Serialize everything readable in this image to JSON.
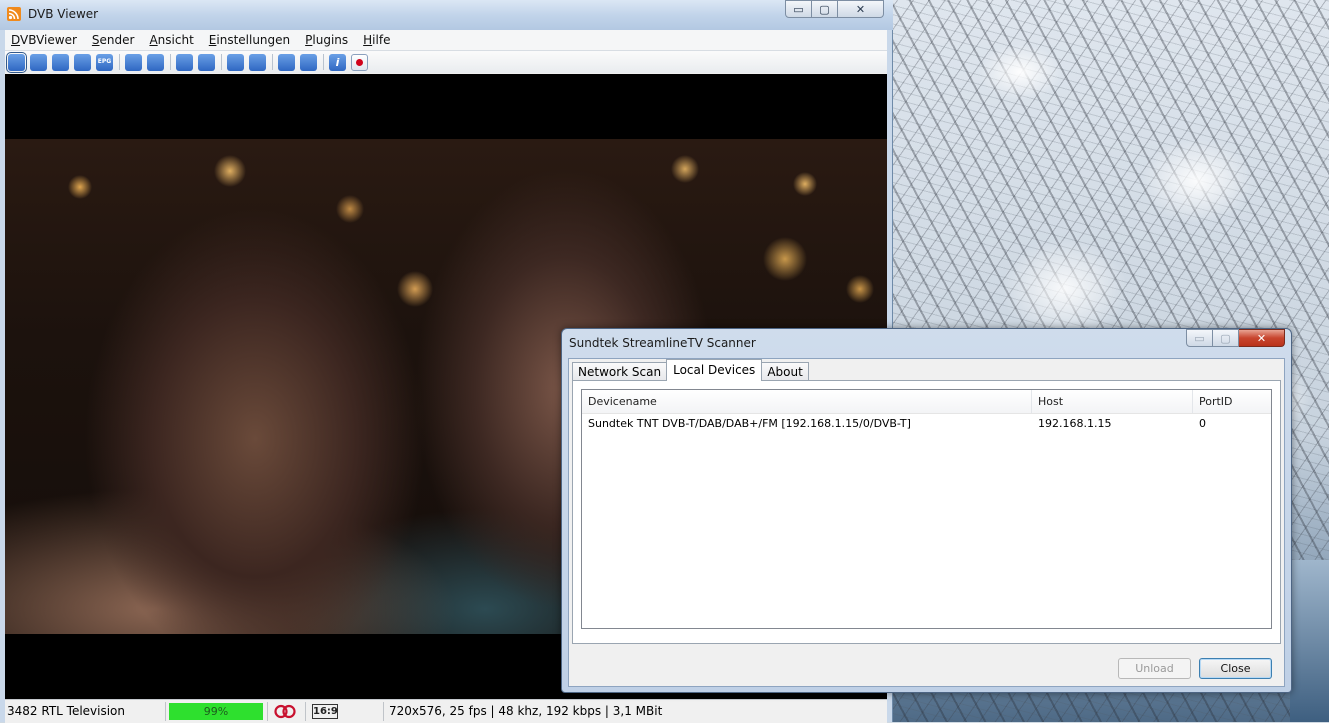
{
  "main_window": {
    "title": "DVB Viewer",
    "controls": {
      "minimize": "▭",
      "maximize": "▢",
      "close": "✕"
    },
    "menu": [
      "DVBViewer",
      "Sender",
      "Ansicht",
      "Einstellungen",
      "Plugins",
      "Hilfe"
    ],
    "toolbar_icons": [
      "fullscreen-icon",
      "move-icon",
      "desktop-icon",
      "osd-icon",
      "epg-icon",
      "previous-channel-icon",
      "next-channel-icon",
      "channel-list-icon",
      "favorites-icon",
      "back-icon",
      "forward-icon",
      "settings-icon",
      "tools-icon",
      "info-icon",
      "record-icon"
    ],
    "toolbar_labels": [
      "",
      "",
      "",
      "",
      "EPG",
      "",
      "",
      "",
      "",
      "",
      "",
      "",
      "",
      "i",
      ""
    ],
    "status": {
      "channel": "3482 RTL Television",
      "signal": "99%",
      "aspect": "16:9",
      "stream_info": "720x576, 25 fps | 48 khz, 192 kbps | 3,1 MBit"
    }
  },
  "scanner": {
    "title": "Sundtek StreamlineTV Scanner",
    "tabs": [
      "Network Scan",
      "Local Devices",
      "About"
    ],
    "active_tab": "Local Devices",
    "columns": [
      "Devicename",
      "Host",
      "PortID"
    ],
    "rows": [
      {
        "device": "Sundtek TNT DVB-T/DAB/DAB+/FM [192.168.1.15/0/DVB-T]",
        "host": "192.168.1.15",
        "port": "0"
      }
    ],
    "buttons": {
      "unload": "Unload",
      "close": "Close"
    },
    "controls": {
      "minimize": "▭",
      "maximize": "▢",
      "close": "✕"
    }
  },
  "colors": {
    "signal_bar": "#2ee02e",
    "close_button": "#c8452e",
    "accent": "#2f67c2"
  }
}
